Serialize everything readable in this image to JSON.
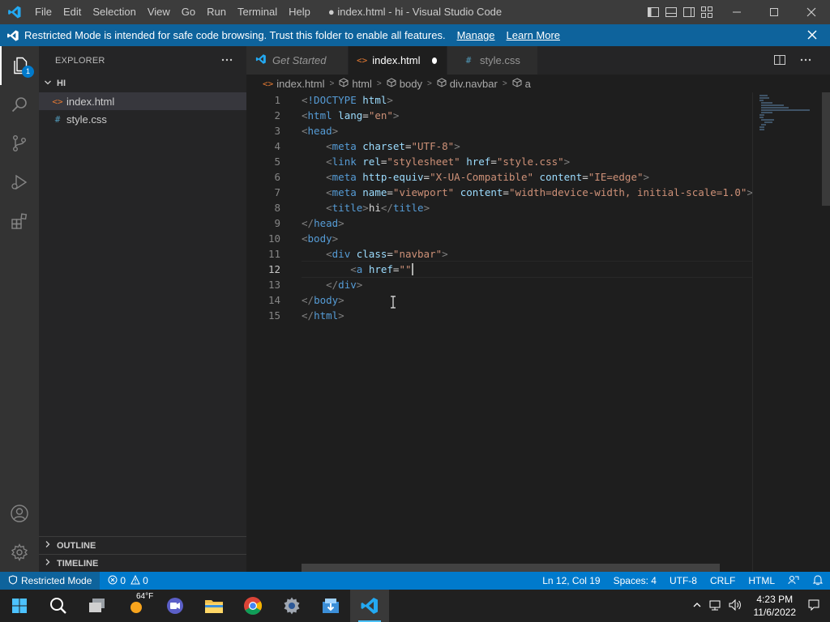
{
  "titlebar": {
    "menu": [
      "File",
      "Edit",
      "Selection",
      "View",
      "Go",
      "Run",
      "Terminal",
      "Help"
    ],
    "title": "● index.html - hi - Visual Studio Code"
  },
  "banner": {
    "message": "Restricted Mode is intended for safe code browsing. Trust this folder to enable all features.",
    "manage": "Manage",
    "learn_more": "Learn More"
  },
  "activitybar": {
    "explorer_badge": "1"
  },
  "sidebar": {
    "title": "EXPLORER",
    "folder": "HI",
    "files": [
      {
        "name": "index.html",
        "icon": "<>"
      },
      {
        "name": "style.css",
        "icon": "#"
      }
    ],
    "outline": "OUTLINE",
    "timeline": "TIMELINE"
  },
  "tabs": [
    {
      "label": "Get Started",
      "icon": "vscode-icon"
    },
    {
      "label": "index.html",
      "icon": "<>"
    },
    {
      "label": "style.css",
      "icon": "#"
    }
  ],
  "breadcrumb": [
    "index.html",
    "html",
    "body",
    "div.navbar",
    "a"
  ],
  "editor": {
    "line_numbers": [
      "1",
      "2",
      "3",
      "4",
      "5",
      "6",
      "7",
      "8",
      "9",
      "10",
      "11",
      "12",
      "13",
      "14",
      "15"
    ],
    "current_line": 12
  },
  "statusbar": {
    "mode": "Restricted Mode",
    "errors": "0",
    "warnings": "0",
    "position": "Ln 12, Col 19",
    "spaces": "Spaces: 4",
    "encoding": "UTF-8",
    "eol": "CRLF",
    "language": "HTML"
  },
  "taskbar": {
    "weather": "64°F",
    "time": "4:23 PM",
    "date": "11/6/2022"
  },
  "colors": {
    "accent": "#007acc",
    "banner": "#0e639c",
    "tag": "#569cd6",
    "attr": "#9cdcfe",
    "string": "#ce9178"
  }
}
